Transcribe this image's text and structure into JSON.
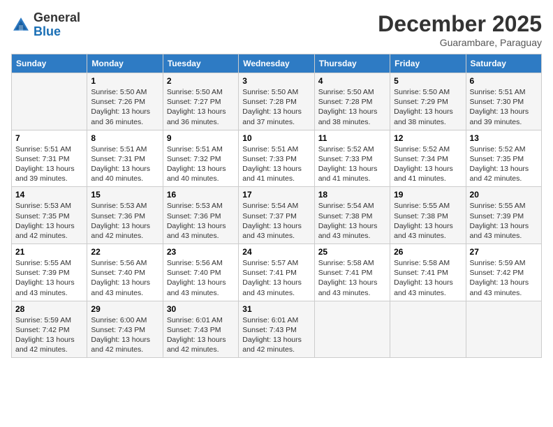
{
  "header": {
    "logo_general": "General",
    "logo_blue": "Blue",
    "month_title": "December 2025",
    "location": "Guarambare, Paraguay"
  },
  "days_of_week": [
    "Sunday",
    "Monday",
    "Tuesday",
    "Wednesday",
    "Thursday",
    "Friday",
    "Saturday"
  ],
  "weeks": [
    [
      {
        "day": "",
        "sunrise": "",
        "sunset": "",
        "daylight": ""
      },
      {
        "day": "1",
        "sunrise": "Sunrise: 5:50 AM",
        "sunset": "Sunset: 7:26 PM",
        "daylight": "Daylight: 13 hours and 36 minutes."
      },
      {
        "day": "2",
        "sunrise": "Sunrise: 5:50 AM",
        "sunset": "Sunset: 7:27 PM",
        "daylight": "Daylight: 13 hours and 36 minutes."
      },
      {
        "day": "3",
        "sunrise": "Sunrise: 5:50 AM",
        "sunset": "Sunset: 7:28 PM",
        "daylight": "Daylight: 13 hours and 37 minutes."
      },
      {
        "day": "4",
        "sunrise": "Sunrise: 5:50 AM",
        "sunset": "Sunset: 7:28 PM",
        "daylight": "Daylight: 13 hours and 38 minutes."
      },
      {
        "day": "5",
        "sunrise": "Sunrise: 5:50 AM",
        "sunset": "Sunset: 7:29 PM",
        "daylight": "Daylight: 13 hours and 38 minutes."
      },
      {
        "day": "6",
        "sunrise": "Sunrise: 5:51 AM",
        "sunset": "Sunset: 7:30 PM",
        "daylight": "Daylight: 13 hours and 39 minutes."
      }
    ],
    [
      {
        "day": "7",
        "sunrise": "Sunrise: 5:51 AM",
        "sunset": "Sunset: 7:31 PM",
        "daylight": "Daylight: 13 hours and 39 minutes."
      },
      {
        "day": "8",
        "sunrise": "Sunrise: 5:51 AM",
        "sunset": "Sunset: 7:31 PM",
        "daylight": "Daylight: 13 hours and 40 minutes."
      },
      {
        "day": "9",
        "sunrise": "Sunrise: 5:51 AM",
        "sunset": "Sunset: 7:32 PM",
        "daylight": "Daylight: 13 hours and 40 minutes."
      },
      {
        "day": "10",
        "sunrise": "Sunrise: 5:51 AM",
        "sunset": "Sunset: 7:33 PM",
        "daylight": "Daylight: 13 hours and 41 minutes."
      },
      {
        "day": "11",
        "sunrise": "Sunrise: 5:52 AM",
        "sunset": "Sunset: 7:33 PM",
        "daylight": "Daylight: 13 hours and 41 minutes."
      },
      {
        "day": "12",
        "sunrise": "Sunrise: 5:52 AM",
        "sunset": "Sunset: 7:34 PM",
        "daylight": "Daylight: 13 hours and 41 minutes."
      },
      {
        "day": "13",
        "sunrise": "Sunrise: 5:52 AM",
        "sunset": "Sunset: 7:35 PM",
        "daylight": "Daylight: 13 hours and 42 minutes."
      }
    ],
    [
      {
        "day": "14",
        "sunrise": "Sunrise: 5:53 AM",
        "sunset": "Sunset: 7:35 PM",
        "daylight": "Daylight: 13 hours and 42 minutes."
      },
      {
        "day": "15",
        "sunrise": "Sunrise: 5:53 AM",
        "sunset": "Sunset: 7:36 PM",
        "daylight": "Daylight: 13 hours and 42 minutes."
      },
      {
        "day": "16",
        "sunrise": "Sunrise: 5:53 AM",
        "sunset": "Sunset: 7:36 PM",
        "daylight": "Daylight: 13 hours and 43 minutes."
      },
      {
        "day": "17",
        "sunrise": "Sunrise: 5:54 AM",
        "sunset": "Sunset: 7:37 PM",
        "daylight": "Daylight: 13 hours and 43 minutes."
      },
      {
        "day": "18",
        "sunrise": "Sunrise: 5:54 AM",
        "sunset": "Sunset: 7:38 PM",
        "daylight": "Daylight: 13 hours and 43 minutes."
      },
      {
        "day": "19",
        "sunrise": "Sunrise: 5:55 AM",
        "sunset": "Sunset: 7:38 PM",
        "daylight": "Daylight: 13 hours and 43 minutes."
      },
      {
        "day": "20",
        "sunrise": "Sunrise: 5:55 AM",
        "sunset": "Sunset: 7:39 PM",
        "daylight": "Daylight: 13 hours and 43 minutes."
      }
    ],
    [
      {
        "day": "21",
        "sunrise": "Sunrise: 5:55 AM",
        "sunset": "Sunset: 7:39 PM",
        "daylight": "Daylight: 13 hours and 43 minutes."
      },
      {
        "day": "22",
        "sunrise": "Sunrise: 5:56 AM",
        "sunset": "Sunset: 7:40 PM",
        "daylight": "Daylight: 13 hours and 43 minutes."
      },
      {
        "day": "23",
        "sunrise": "Sunrise: 5:56 AM",
        "sunset": "Sunset: 7:40 PM",
        "daylight": "Daylight: 13 hours and 43 minutes."
      },
      {
        "day": "24",
        "sunrise": "Sunrise: 5:57 AM",
        "sunset": "Sunset: 7:41 PM",
        "daylight": "Daylight: 13 hours and 43 minutes."
      },
      {
        "day": "25",
        "sunrise": "Sunrise: 5:58 AM",
        "sunset": "Sunset: 7:41 PM",
        "daylight": "Daylight: 13 hours and 43 minutes."
      },
      {
        "day": "26",
        "sunrise": "Sunrise: 5:58 AM",
        "sunset": "Sunset: 7:41 PM",
        "daylight": "Daylight: 13 hours and 43 minutes."
      },
      {
        "day": "27",
        "sunrise": "Sunrise: 5:59 AM",
        "sunset": "Sunset: 7:42 PM",
        "daylight": "Daylight: 13 hours and 43 minutes."
      }
    ],
    [
      {
        "day": "28",
        "sunrise": "Sunrise: 5:59 AM",
        "sunset": "Sunset: 7:42 PM",
        "daylight": "Daylight: 13 hours and 42 minutes."
      },
      {
        "day": "29",
        "sunrise": "Sunrise: 6:00 AM",
        "sunset": "Sunset: 7:43 PM",
        "daylight": "Daylight: 13 hours and 42 minutes."
      },
      {
        "day": "30",
        "sunrise": "Sunrise: 6:01 AM",
        "sunset": "Sunset: 7:43 PM",
        "daylight": "Daylight: 13 hours and 42 minutes."
      },
      {
        "day": "31",
        "sunrise": "Sunrise: 6:01 AM",
        "sunset": "Sunset: 7:43 PM",
        "daylight": "Daylight: 13 hours and 42 minutes."
      },
      {
        "day": "",
        "sunrise": "",
        "sunset": "",
        "daylight": ""
      },
      {
        "day": "",
        "sunrise": "",
        "sunset": "",
        "daylight": ""
      },
      {
        "day": "",
        "sunrise": "",
        "sunset": "",
        "daylight": ""
      }
    ]
  ]
}
